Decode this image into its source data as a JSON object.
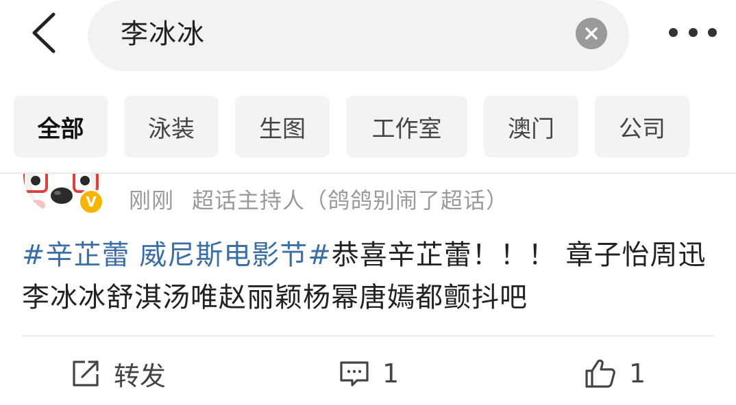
{
  "header": {
    "back_icon": "chevron-left-icon",
    "search_query": "李冰冰",
    "clear_icon": "close-icon",
    "more_icon": "more-horizontal-icon"
  },
  "filters": [
    {
      "label": "全部",
      "active": true
    },
    {
      "label": "泳装",
      "active": false
    },
    {
      "label": "生图",
      "active": false
    },
    {
      "label": "工作室",
      "active": false
    },
    {
      "label": "澳门",
      "active": false
    },
    {
      "label": "公司",
      "active": false
    }
  ],
  "post": {
    "verified_badge": "V",
    "time": "刚刚",
    "source": "超话主持人（鸽鸽别闹了超话）",
    "topic": "#辛芷蕾 威尼斯电影节#",
    "text": "恭喜辛芷蕾！！！ 章子怡周迅李冰冰舒淇汤唯赵丽颖杨幂唐嫣都颤抖吧"
  },
  "actions": {
    "repost_label": "转发",
    "repost_icon": "share-icon",
    "comment_count": "1",
    "comment_icon": "comment-icon",
    "like_count": "1",
    "like_icon": "thumbs-up-icon"
  },
  "colors": {
    "topic": "#3a6ea5",
    "badge": "#f7b500",
    "search_bg": "#f2f2f2",
    "chip_bg": "#f3f3f3"
  }
}
